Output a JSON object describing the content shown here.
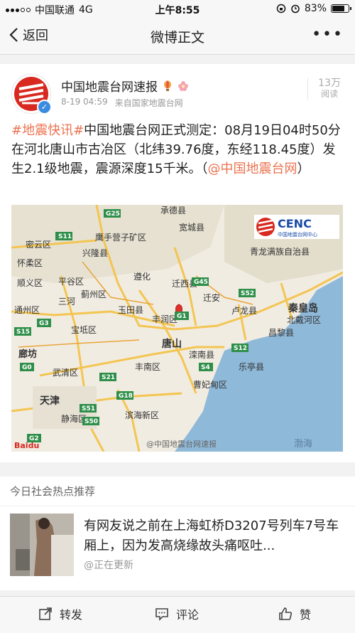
{
  "status_bar": {
    "carrier": "中国联通",
    "network": "4G",
    "time": "上午8:55",
    "battery": "83%",
    "battery_level": 0.83
  },
  "nav": {
    "back_label": "返回",
    "title": "微博正文",
    "more_label": "•••"
  },
  "post": {
    "author": "中国地震台网速报",
    "time": "8-19 04:59",
    "source": "来自国家地震台网",
    "reads_count": "13万",
    "reads_label": "阅读",
    "text_tag1": "#地震快讯#",
    "text_body": "中国地震台网正式测定：08月19日04时50分在河北唐山市古冶区（北纬39.76度，东经118.45度）发生2.1级地震，震源深度15千米。（",
    "text_mention": "@中国地震台网",
    "text_end": "）"
  },
  "map": {
    "cenc_logo": "CENC",
    "cenc_sub": "中国地震台网中心",
    "watermark": "@中国地震台网速报",
    "baidu": "Baidu",
    "labels": {
      "chengde": "承德县",
      "kuancheng": "宽城县",
      "yingshouyingzi": "鹰手营子矿区",
      "xinglong": "兴隆县",
      "qinglong": "青龙满族自治县",
      "huairou": "怀柔区",
      "miyun": "密云区",
      "shunyi": "顺义区",
      "pinggu": "平谷区",
      "zunhua": "遵化",
      "qianxi": "迁西县",
      "jizhou": "蓟州区",
      "sanhe": "三河",
      "tongzhou": "通州区",
      "yutian": "玉田县",
      "fengrun": "丰润区",
      "qian_an": "迁安",
      "lulong": "卢龙县",
      "qinhuangdao": "秦皇岛",
      "beidaihe": "北戴河区",
      "changli": "昌黎县",
      "tangshan": "唐山",
      "baodi": "宝坻区",
      "langfang": "廊坊",
      "wuqing": "武清区",
      "fengnan": "丰南区",
      "luannan": "滦南县",
      "laoting": "乐亭县",
      "caofeidian": "曹妃甸区",
      "tianjin": "天津",
      "jinghai": "静海区",
      "binhai": "滨海新区",
      "bohai": "渤海",
      "g25": "G25",
      "s11": "S11",
      "g45": "G45",
      "g1": "G1",
      "s52": "S52",
      "s15": "S15",
      "g3": "G3",
      "s12": "S12",
      "s4": "S4",
      "s21": "S21",
      "s51": "S51",
      "s50": "S50",
      "g18": "G18",
      "g2": "G2",
      "g0": "G0"
    }
  },
  "hot": {
    "title": "今日社会热点推荐",
    "text": "有网友说之前在上海虹桥D3207号列车7号车厢上，因为发高烧缘故头痛呕吐...",
    "source": "@正在更新"
  },
  "actions": {
    "repost": "转发",
    "comment": "评论",
    "like": "赞"
  },
  "colors": {
    "link": "#eb7350",
    "verified": "#3b8be0",
    "sea": "#8fb9d9",
    "land": "#f1ece2",
    "road": "#f3c552",
    "epicenter": "#e0322b"
  }
}
